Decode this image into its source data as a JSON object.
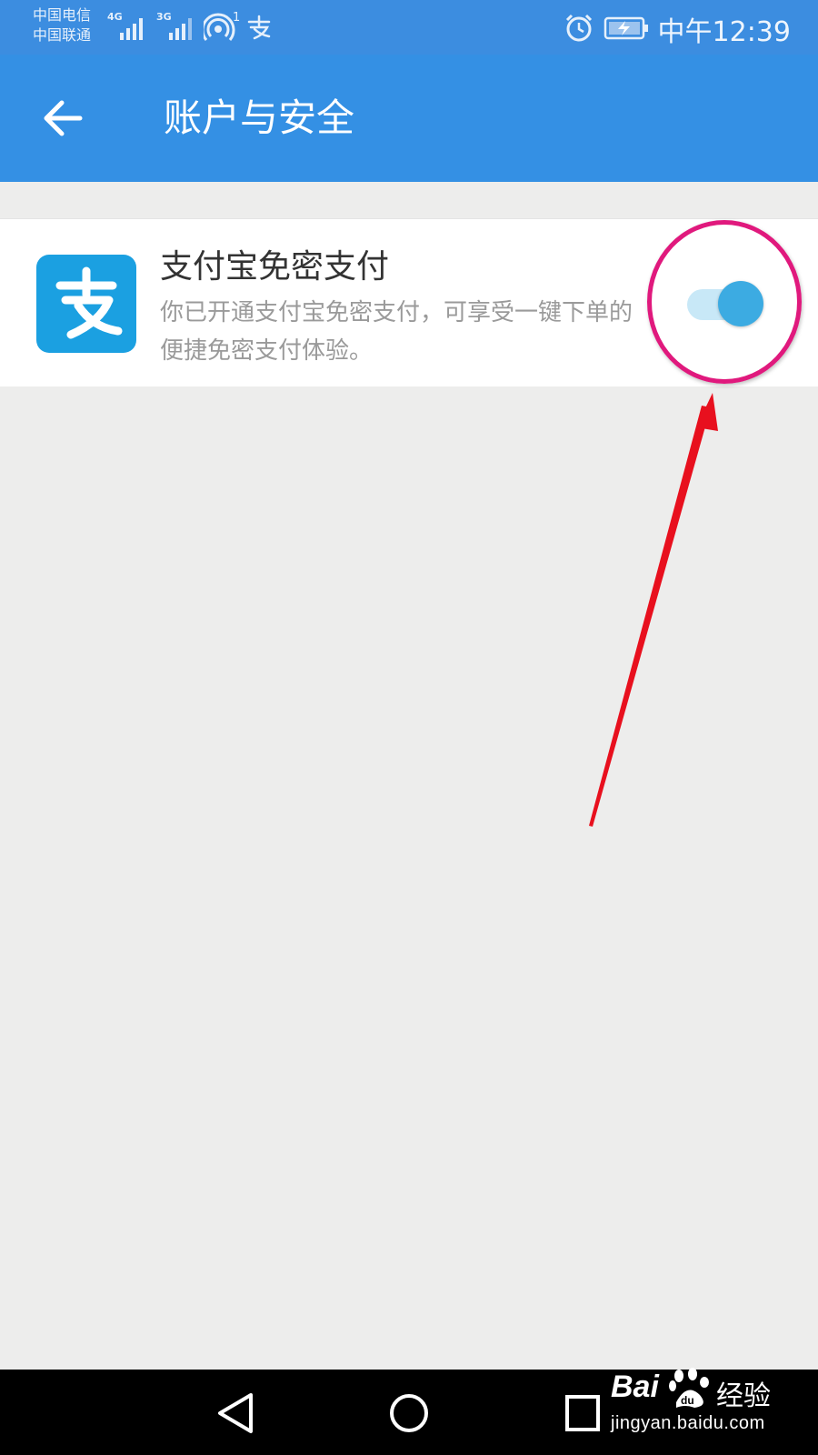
{
  "status_bar": {
    "carrier_1": "中国电信",
    "carrier_2": "中国联通",
    "network_1": "4G",
    "network_2": "3G",
    "hotspot_count": "1",
    "time": "中午12:39"
  },
  "app_bar": {
    "title": "账户与安全"
  },
  "setting": {
    "title": "支付宝免密支付",
    "description": "你已开通支付宝免密支付，可享受一键下单的便捷免密支付体验。",
    "enabled": true,
    "logo_glyph": "支"
  },
  "watermark": {
    "brand_left": "Bai",
    "brand_right": "经验",
    "url": "jingyan.baidu.com",
    "paw_text": "du"
  },
  "colors": {
    "status_bar": "#3c8de0",
    "app_bar": "#3490e4",
    "alipay_blue": "#1ba0e1",
    "toggle_thumb": "#3cabe2",
    "annotation_circle": "#e0197d",
    "annotation_arrow": "#e8101e",
    "background": "#ededec"
  },
  "icons": {
    "back": "arrow-left-icon",
    "alarm": "alarm-clock-icon",
    "battery": "battery-charging-icon",
    "hotspot": "hotspot-icon",
    "alipay_status": "alipay-status-icon",
    "nav_back": "triangle-back-icon",
    "nav_home": "circle-home-icon",
    "nav_recents": "square-recents-icon"
  }
}
